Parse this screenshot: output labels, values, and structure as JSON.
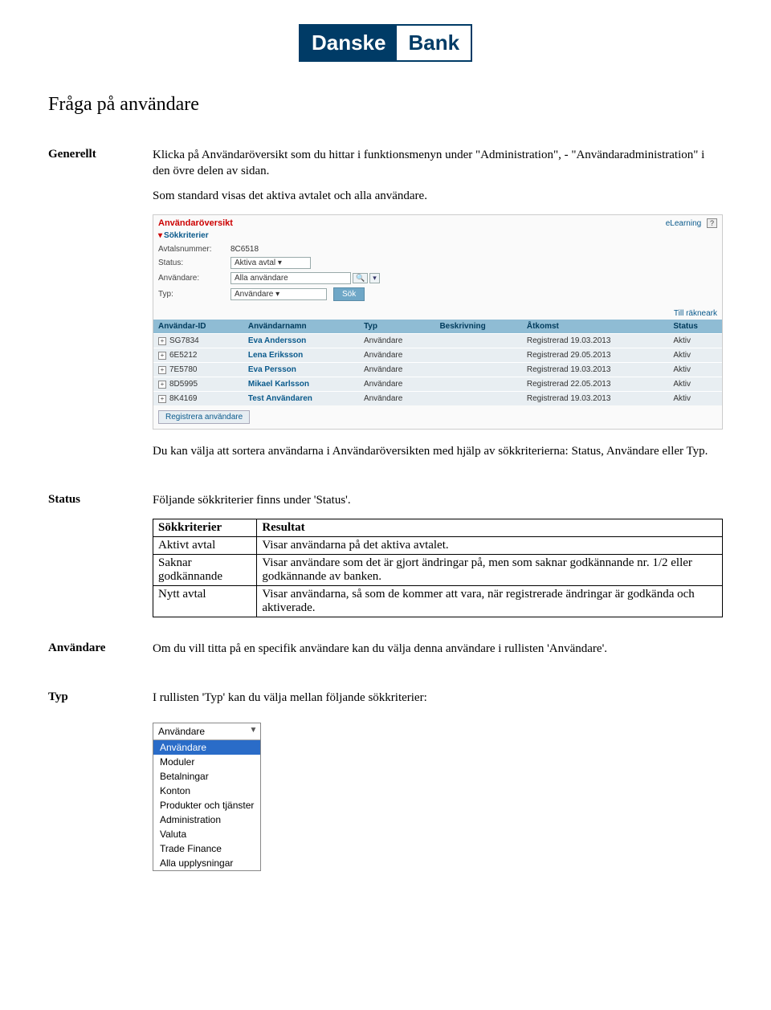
{
  "logo": {
    "left": "Danske",
    "right": "Bank"
  },
  "page_title": "Fråga på användare",
  "sections": {
    "generellt": {
      "label": "Generellt",
      "p1": "Klicka på Användaröversikt som du hittar i funktionsmenyn under \"Administration\", - \"Användaradministration\" i den övre delen av sidan.",
      "p2": "Som standard visas det aktiva avtalet och alla användare.",
      "p3": "Du kan välja att sortera användarna i Användaröversikten med hjälp av sökkriterierna: Status, Användare eller Typ."
    },
    "status": {
      "label": "Status",
      "intro": "Följande sökkriterier finns under 'Status'.",
      "table": {
        "h1": "Sökkriterier",
        "h2": "Resultat",
        "rows": [
          {
            "k": "Aktivt avtal",
            "v": "Visar användarna på det aktiva avtalet."
          },
          {
            "k": "Saknar godkännande",
            "v": "Visar användare som det är gjort ändringar på, men som saknar godkännande nr. 1/2 eller godkännande av banken."
          },
          {
            "k": "Nytt avtal",
            "v": "Visar användarna, så som de kommer att vara, när registrerade ändringar är godkända och aktiverade."
          }
        ]
      }
    },
    "anvandare": {
      "label": "Användare",
      "text": "Om du vill titta på en specifik användare kan du välja denna användare i rullisten 'Användare'."
    },
    "typ": {
      "label": "Typ",
      "text": "I rullisten 'Typ' kan du välja mellan följande sökkriterier:"
    }
  },
  "ui": {
    "title": "Användaröversikt",
    "elearning": "eLearning",
    "subhead": "Sökkriterier",
    "filters": {
      "avtalsnummer_label": "Avtalsnummer:",
      "avtalsnummer_value": "8C6518",
      "status_label": "Status:",
      "status_value": "Aktiva avtal",
      "anvandare_label": "Användare:",
      "anvandare_value": "Alla användare",
      "typ_label": "Typ:",
      "typ_value": "Användare",
      "search_btn": "Sök"
    },
    "link_right": "Till räkneark",
    "table": {
      "headers": [
        "Användar-ID",
        "Användarnamn",
        "Typ",
        "Beskrivning",
        "Åtkomst",
        "Status"
      ],
      "rows": [
        {
          "id": "SG7834",
          "name": "Eva Andersson",
          "typ": "Användare",
          "beskr": "",
          "atkomst": "Registrerad 19.03.2013",
          "status": "Aktiv"
        },
        {
          "id": "6E5212",
          "name": "Lena Eriksson",
          "typ": "Användare",
          "beskr": "",
          "atkomst": "Registrerad 29.05.2013",
          "status": "Aktiv"
        },
        {
          "id": "7E5780",
          "name": "Eva Persson",
          "typ": "Användare",
          "beskr": "",
          "atkomst": "Registrerad 19.03.2013",
          "status": "Aktiv"
        },
        {
          "id": "8D5995",
          "name": "Mikael Karlsson",
          "typ": "Användare",
          "beskr": "",
          "atkomst": "Registrerad 22.05.2013",
          "status": "Aktiv"
        },
        {
          "id": "8K4169",
          "name": "Test Användaren",
          "typ": "Användare",
          "beskr": "",
          "atkomst": "Registrerad 19.03.2013",
          "status": "Aktiv"
        }
      ]
    },
    "register_btn": "Registrera användare"
  },
  "dropdown": {
    "selected": "Användare",
    "items": [
      "Användare",
      "Moduler",
      "Betalningar",
      "Konton",
      "Produkter och tjänster",
      "Administration",
      "Valuta",
      "Trade Finance",
      "Alla upplysningar"
    ]
  }
}
